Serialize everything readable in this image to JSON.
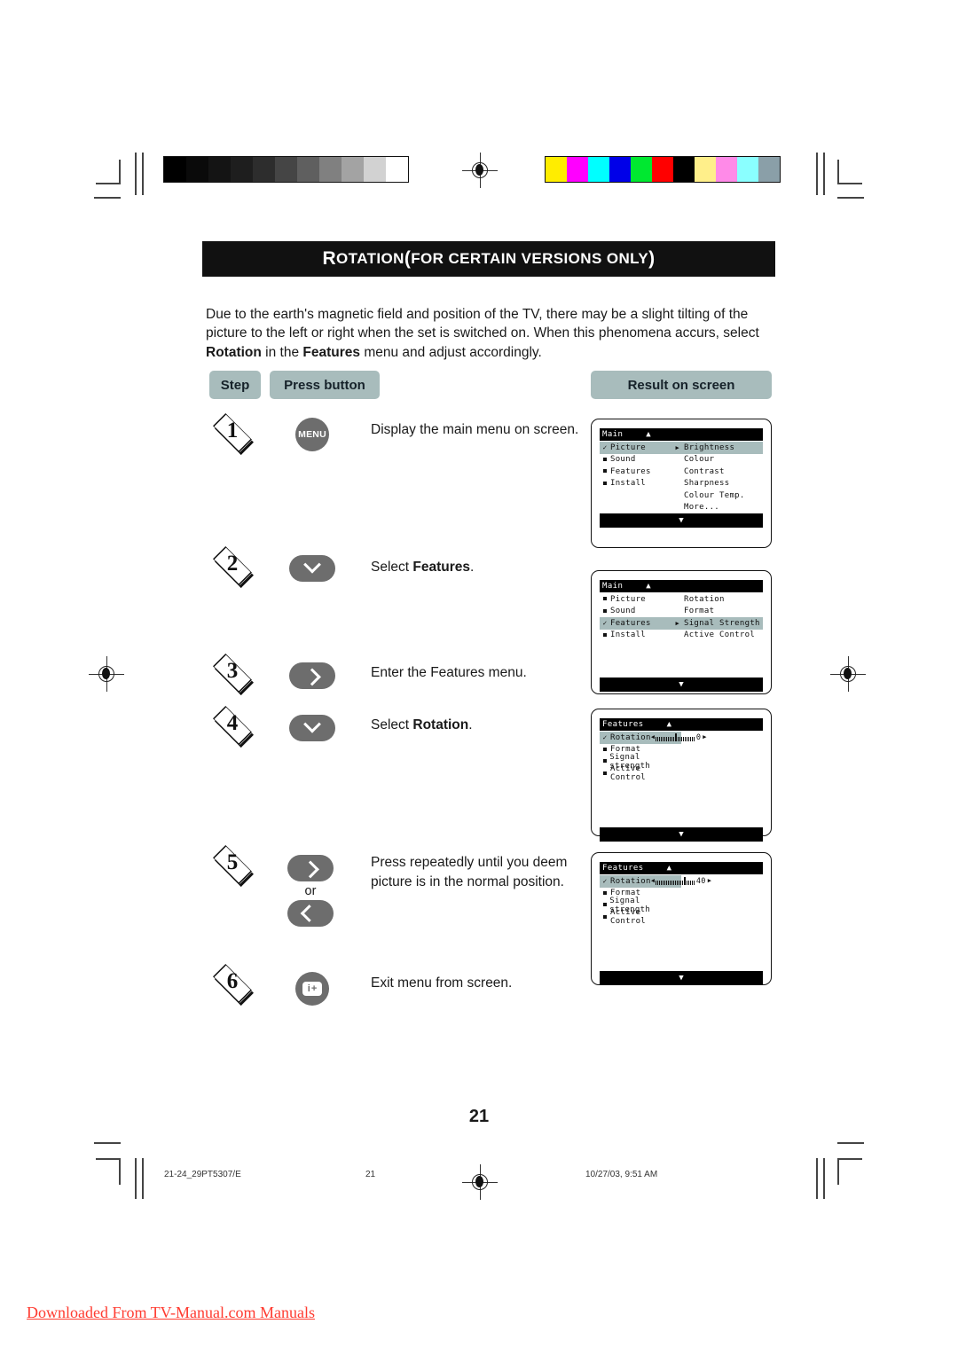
{
  "section": {
    "title_lead": "R",
    "title_rest": "OTATION",
    "title_paren_open": " (",
    "title_small": "FOR CERTAIN VERSIONS ONLY",
    "title_paren_close": ")",
    "title_full": "ROTATION (FOR CERTAIN VERSIONS ONLY)"
  },
  "intro": {
    "part1": "Due to the earth's magnetic field and position of the TV, there may be a slight tilting of the picture to the left or right when the set is switched on. When this phenomena accurs, select ",
    "bold1": "Rotation",
    "part2": " in the ",
    "bold2": "Features",
    "part3": " menu and adjust accordingly."
  },
  "table_headers": {
    "step": "Step",
    "press_button": "Press button",
    "result_on_screen": "Result on screen"
  },
  "steps": [
    {
      "number": "1",
      "button": "MENU",
      "button_kind": "round-text",
      "instruction": "Display the main menu on screen."
    },
    {
      "number": "2",
      "button": "chevron-down",
      "button_kind": "pill-chevron",
      "instruction_pre": "Select ",
      "instruction_bold": "Features",
      "instruction_post": "."
    },
    {
      "number": "3",
      "button": "chevron-right",
      "button_kind": "pill-chevron",
      "instruction": "Enter the Features menu."
    },
    {
      "number": "4",
      "button": "chevron-down",
      "button_kind": "pill-chevron",
      "instruction_pre": "Select ",
      "instruction_bold": "Rotation",
      "instruction_post": "."
    },
    {
      "number": "5",
      "button": "chevron-right",
      "button2": "chevron-left",
      "or_label": "or",
      "button_kind": "pill-chevron-pair",
      "instruction": "Press repeatedly until you deem picture is in the normal position."
    },
    {
      "number": "6",
      "button": "info-plus",
      "button_kind": "round-icon",
      "instruction": "Exit menu from screen."
    }
  ],
  "screens": [
    {
      "id": "screen-main-picture",
      "header": "Main",
      "header_arrow": "▲",
      "bottom_arrow": "▼",
      "left_items": [
        {
          "label": "Picture",
          "mark": "check",
          "selected": true,
          "submenu_arrow": "▶"
        },
        {
          "label": "Sound",
          "mark": "square",
          "selected": false
        },
        {
          "label": "Features",
          "mark": "square",
          "selected": false
        },
        {
          "label": "Install",
          "mark": "square",
          "selected": false
        }
      ],
      "right_items": [
        {
          "label": "Brightness",
          "selected": true
        },
        {
          "label": "Colour",
          "selected": false
        },
        {
          "label": "Contrast",
          "selected": false
        },
        {
          "label": "Sharpness",
          "selected": false
        },
        {
          "label": "Colour Temp.",
          "selected": false
        },
        {
          "label": "More...",
          "selected": false
        }
      ]
    },
    {
      "id": "screen-main-features",
      "header": "Main",
      "header_arrow": "▲",
      "bottom_arrow": "▼",
      "left_items": [
        {
          "label": "Picture",
          "mark": "square",
          "selected": false
        },
        {
          "label": "Sound",
          "mark": "square",
          "selected": false
        },
        {
          "label": "Features",
          "mark": "check",
          "selected": true,
          "submenu_arrow": "▶"
        },
        {
          "label": "Install",
          "mark": "square",
          "selected": false
        }
      ],
      "right_items": [
        {
          "label": "Rotation",
          "selected": false
        },
        {
          "label": "Format",
          "selected": false
        },
        {
          "label": "Signal Strength",
          "selected": true
        },
        {
          "label": "Active Control",
          "selected": false
        }
      ]
    },
    {
      "id": "screen-features-rotation-0",
      "header": "Features",
      "header_arrow": "▲",
      "bottom_arrow": "▼",
      "left_items": [
        {
          "label": "Rotation",
          "mark": "check",
          "selected": true,
          "slider": {
            "value": "0",
            "percent": 50,
            "left_arrow": "◀",
            "right_arrow": "▶"
          }
        },
        {
          "label": "Format",
          "mark": "square",
          "selected": false
        },
        {
          "label": "Signal strength",
          "mark": "square",
          "selected": false
        },
        {
          "label": "Active Control",
          "mark": "square",
          "selected": false
        }
      ],
      "right_items": []
    },
    {
      "id": "screen-features-rotation-40",
      "header": "Features",
      "header_arrow": "▲",
      "bottom_arrow": "▼",
      "left_items": [
        {
          "label": "Rotation",
          "mark": "check",
          "selected": true,
          "slider": {
            "value": "40",
            "percent": 72,
            "left_arrow": "◀",
            "right_arrow": "▶"
          }
        },
        {
          "label": "Format",
          "mark": "square",
          "selected": false
        },
        {
          "label": "Signal strength",
          "mark": "square",
          "selected": false
        },
        {
          "label": "Active Control",
          "mark": "square",
          "selected": false
        }
      ],
      "right_items": []
    }
  ],
  "page_number": "21",
  "footer": {
    "filename": "21-24_29PT5307/E",
    "page": "21",
    "timestamp": "10/27/03, 9:51 AM"
  },
  "watermark": "Downloaded From TV-Manual.com Manuals",
  "calibration": {
    "grayscale": [
      "#000000",
      "#0a0a0a",
      "#141414",
      "#1e1e1e",
      "#2d2d2d",
      "#454545",
      "#5f5f5f",
      "#808080",
      "#a3a3a3",
      "#d2d2d2",
      "#ffffff"
    ],
    "colors": [
      "#ffed00",
      "#ff00ff",
      "#00ffff",
      "#0000e8",
      "#00e830",
      "#ff0000",
      "#000000",
      "#ffef8a",
      "#ff8ae8",
      "#8affff",
      "#8a9fa8"
    ]
  }
}
